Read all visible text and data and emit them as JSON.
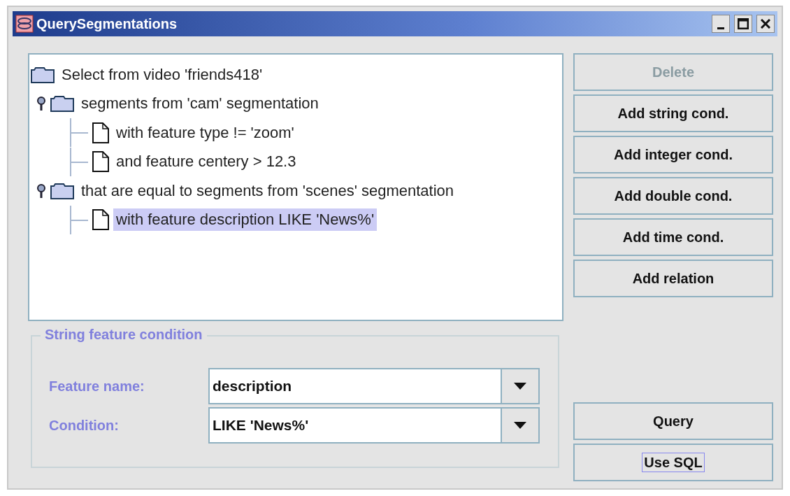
{
  "window": {
    "title": "QuerySegmentations"
  },
  "tree": {
    "label": "Select from video 'friends418'",
    "kind": "folder",
    "selected": false,
    "children": [
      {
        "label": "segments from 'cam' segmentation",
        "kind": "folder",
        "expanded": true,
        "selected": false,
        "children": [
          {
            "label": "with feature type != 'zoom'",
            "kind": "leaf",
            "selected": false
          },
          {
            "label": "and feature centery > 12.3",
            "kind": "leaf",
            "selected": false
          }
        ]
      },
      {
        "label": "that are equal to segments from 'scenes' segmentation",
        "kind": "folder",
        "expanded": true,
        "selected": false,
        "children": [
          {
            "label": "with feature description LIKE 'News%'",
            "kind": "leaf",
            "selected": true
          }
        ]
      }
    ]
  },
  "buttons": [
    {
      "label": "Delete",
      "disabled": true
    },
    {
      "label": "Add string cond.",
      "disabled": false
    },
    {
      "label": "Add integer cond.",
      "disabled": false
    },
    {
      "label": "Add double cond.",
      "disabled": false
    },
    {
      "label": "Add time cond.",
      "disabled": false
    },
    {
      "label": "Add relation",
      "disabled": false
    }
  ],
  "condition_group": {
    "title": "String feature condition",
    "fields": [
      {
        "label": "Feature name:",
        "value": "description"
      },
      {
        "label": "Condition:",
        "value": "LIKE 'News%'"
      }
    ]
  },
  "actions": [
    {
      "label": "Query",
      "focused": false
    },
    {
      "label": "Use SQL",
      "focused": true
    }
  ]
}
